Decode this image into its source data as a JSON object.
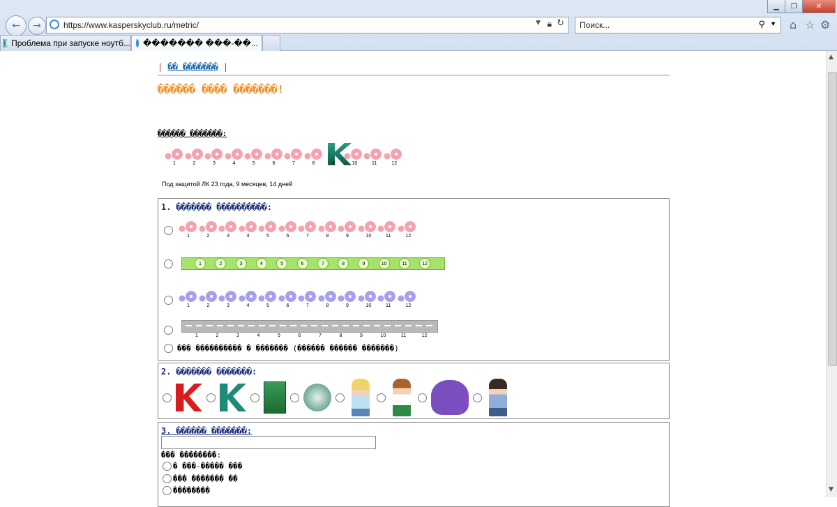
{
  "browser": {
    "url": "https://www.kasperskyclub.ru/metric/",
    "url_host": "kasperskyclub.ru",
    "search_placeholder": "Поиск...",
    "tabs": [
      {
        "label": "Проблема при запуске ноутб..."
      },
      {
        "label": "������� ���-��..."
      }
    ]
  },
  "page": {
    "top_link": "�� �������",
    "heading": "������ ���� �������!",
    "current_label": "������ �������:",
    "protection_text": "Под защитой ЛК 23 года, 9 месяцев, 14 дней",
    "ticks": [
      "1",
      "2",
      "3",
      "4",
      "5",
      "6",
      "7",
      "8",
      "9",
      "10",
      "11",
      "12"
    ],
    "q1": {
      "title": "1. ������� ����������:",
      "last_option": "��� ���������� � ������� (������ ������ �������)"
    },
    "q2": {
      "title": "2. ������� �������:"
    },
    "q3": {
      "title": "3. ������ �������:",
      "sub_label": "��� ��������:",
      "options": [
        "� ���-����� ���",
        "��� ������� ��",
        "��������"
      ]
    }
  },
  "colors": {
    "accent": "#f0902a",
    "link": "#1a6bb0",
    "qtitle": "#1c2f7a"
  }
}
